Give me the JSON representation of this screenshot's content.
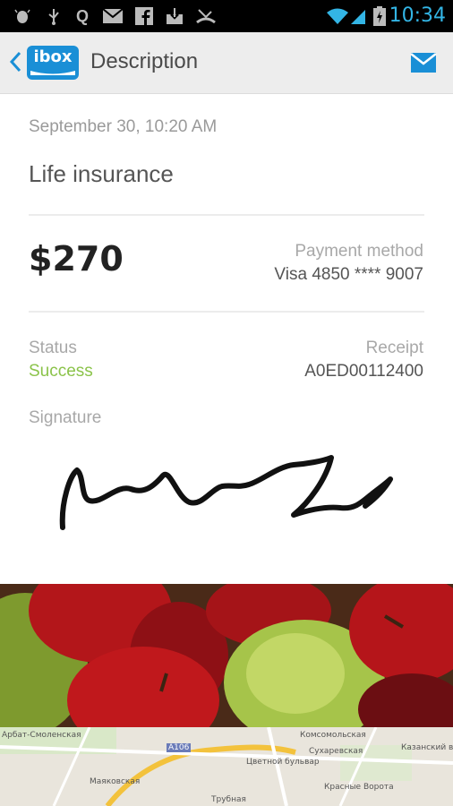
{
  "status_bar": {
    "time": "10:34",
    "icons": [
      "android-debug-icon",
      "usb-icon",
      "q-app-icon",
      "gmail-icon",
      "facebook-icon",
      "download-icon",
      "missed-call-icon",
      "wifi-icon",
      "signal-icon",
      "battery-charging-icon"
    ]
  },
  "appbar": {
    "logo_text": "ibox",
    "title": "Description"
  },
  "receipt": {
    "date": "September 30, 10:20 AM",
    "purpose": "Life insurance",
    "amount": "$270",
    "payment_method_label": "Payment method",
    "payment_method_value": "Visa 4850 **** 9007",
    "status_label": "Status",
    "status_value": "Success",
    "receipt_label": "Receipt",
    "receipt_value": "A0ED00112400",
    "signature_label": "Signature"
  },
  "map_labels": {
    "a": "Арбат-Смоленская",
    "b": "Маяковская",
    "c": "Цветной бульвар",
    "d": "Сухаревская",
    "e": "Комсомольская",
    "f": "Казанский вокзал",
    "g": "Красные Ворота",
    "h": "Трубная",
    "i": "A106"
  },
  "colors": {
    "accent": "#33b5e5",
    "logo": "#1a8fd6",
    "success": "#8bc34a"
  }
}
